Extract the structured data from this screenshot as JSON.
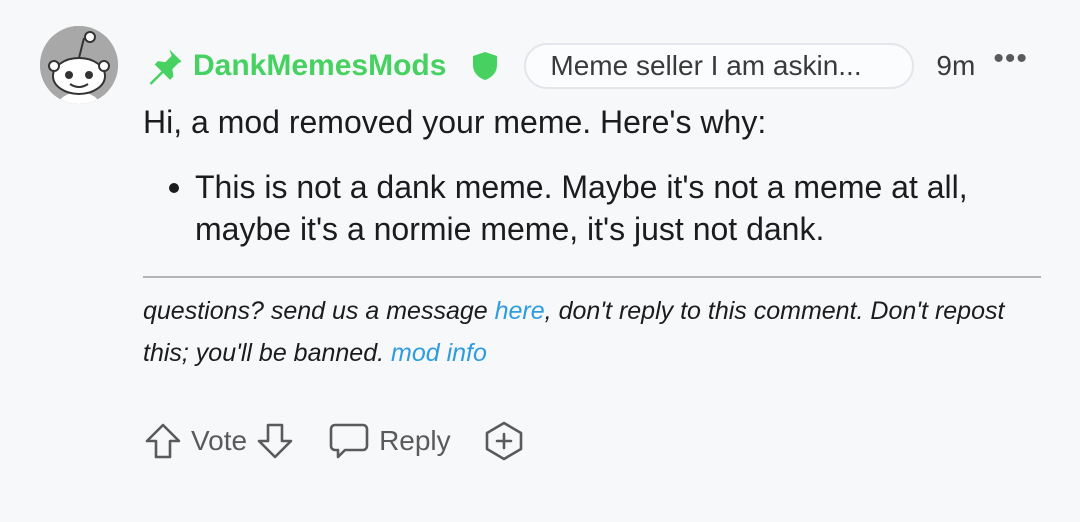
{
  "comment": {
    "author": "DankMemesMods",
    "flair": "Meme seller I am askin...",
    "time": "9m",
    "more": "•••",
    "intro": "Hi, a mod removed your meme. Here's why:",
    "reasons": [
      "This is not a dank meme. Maybe it's not a meme at all, maybe it's a normie meme, it's just not dank."
    ],
    "footer": {
      "part1": "questions? send us a message ",
      "link_here": "here",
      "part2": ", don't reply to this comment. Don't repost this; you'll be banned. ",
      "link_modinfo": "mod info"
    }
  },
  "actions": {
    "vote_label": "Vote",
    "reply_label": "Reply"
  },
  "colors": {
    "author": "#46d160",
    "link": "#2f9ce0",
    "background": "#f6f8fa"
  }
}
